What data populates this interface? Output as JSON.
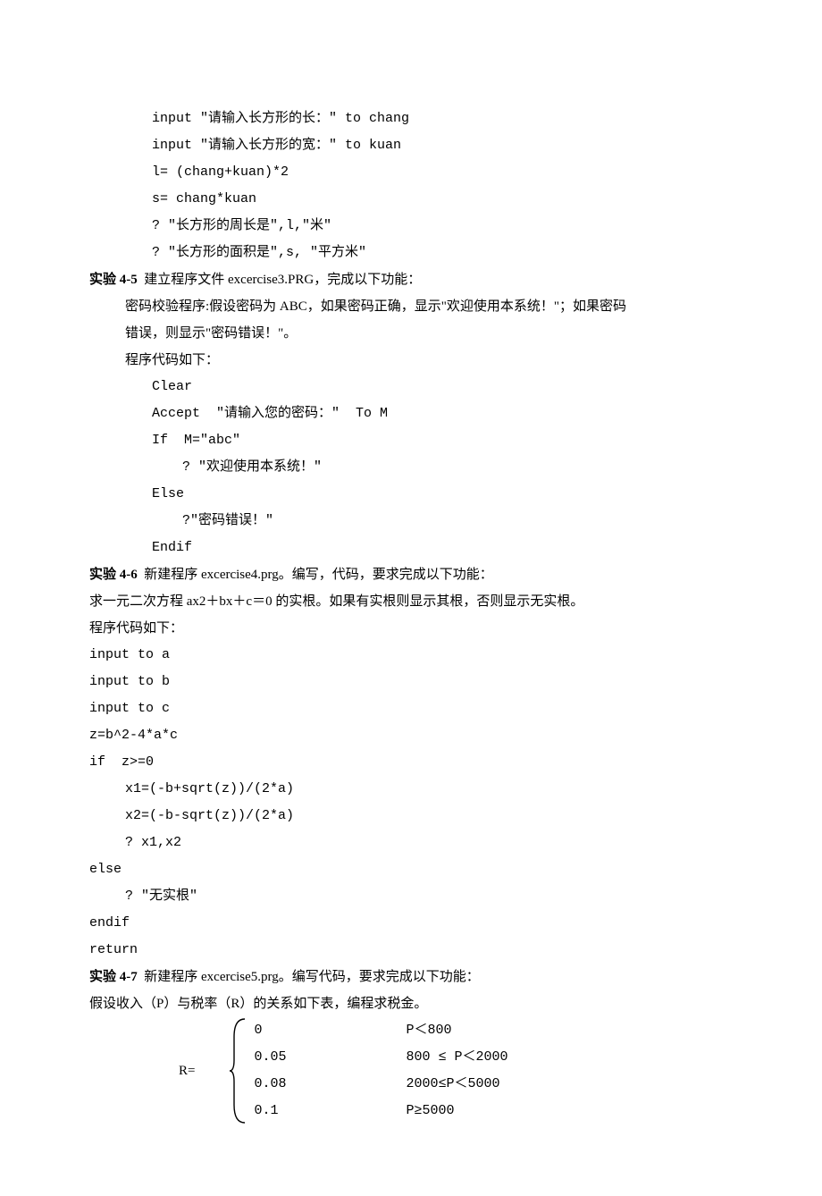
{
  "block45_code": [
    "input \"请输入长方形的长：\" to chang",
    "input \"请输入长方形的宽：\" to kuan",
    "l= (chang+kuan)*2",
    "s= chang*kuan",
    "? \"长方形的周长是\",l,\"米\"",
    "? \"长方形的面积是\",s, \"平方米\""
  ],
  "exp45": {
    "title": "实验 4-5",
    "desc": "  建立程序文件 excercise3.PRG，完成以下功能：",
    "p1": "密码校验程序:假设密码为 ABC，如果密码正确，显示\"欢迎使用本系统！\"；如果密码",
    "p2": "错误，则显示\"密码错误！\"。",
    "p3": "程序代码如下：",
    "code": [
      {
        "indent": "indent1",
        "text": "Clear"
      },
      {
        "indent": "indent1",
        "text": "Accept  \"请输入您的密码：\"  To M"
      },
      {
        "indent": "indent1",
        "text": "If  M=\"abc\""
      },
      {
        "indent": "indent2",
        "text": "? \"欢迎使用本系统！\""
      },
      {
        "indent": "indent1",
        "text": "Else"
      },
      {
        "indent": "indent2",
        "text": "?\"密码错误！\""
      },
      {
        "indent": "indent1",
        "text": "Endif"
      }
    ]
  },
  "exp46": {
    "title": "实验 4-6",
    "desc": "  新建程序 excercise4.prg。编写，代码，要求完成以下功能：",
    "p1": "求一元二次方程 ax2＋bx＋c＝0 的实根。如果有实根则显示其根，否则显示无实根。",
    "p2": "程序代码如下：",
    "code": [
      {
        "indent": "indent0",
        "text": "input to a"
      },
      {
        "indent": "indent0",
        "text": "input to b"
      },
      {
        "indent": "indent0",
        "text": "input to c"
      },
      {
        "indent": "indent0",
        "text": "z=b^2-4*a*c"
      },
      {
        "indent": "indent0",
        "text": "if  z>=0"
      },
      {
        "indent": "indent3",
        "text": "x1=(-b+sqrt(z))/(2*a)"
      },
      {
        "indent": "indent3",
        "text": "x2=(-b-sqrt(z))/(2*a)"
      },
      {
        "indent": "indent3",
        "text": "? x1,x2"
      },
      {
        "indent": "indent0",
        "text": "else"
      },
      {
        "indent": "indent3",
        "text": "? \"无实根\""
      },
      {
        "indent": "indent0",
        "text": "endif"
      },
      {
        "indent": "indent0",
        "text": "return"
      }
    ]
  },
  "exp47": {
    "title": "实验 4-7",
    "desc": "  新建程序 excercise5.prg。编写代码，要求完成以下功能：",
    "p1": "假设收入（P）与税率（R）的关系如下表，编程求税金。",
    "r_label": "R=",
    "rows": [
      {
        "rate": "0",
        "cond": "P＜800"
      },
      {
        "rate": "0.05",
        "cond": "800 ≤ P＜2000"
      },
      {
        "rate": "0.08",
        "cond": "2000≤P＜5000"
      },
      {
        "rate": "0.1",
        "cond": "P≥5000"
      }
    ]
  }
}
